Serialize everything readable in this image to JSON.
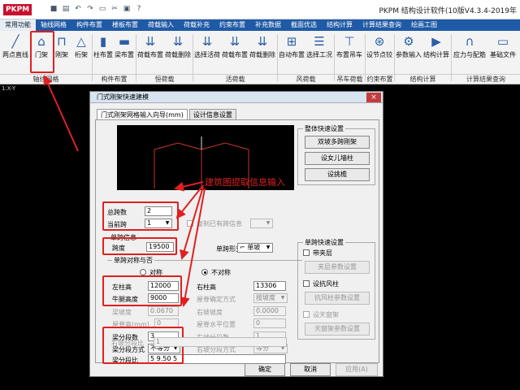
{
  "app": {
    "logo": "PKPM",
    "title": "PKPM 结构设计软件(10版V4.3.4-2019年",
    "quick_icons": [
      "save-icon",
      "print-icon",
      "undo-icon",
      "redo-icon",
      "folder-icon",
      "cut-icon",
      "paste-icon",
      "help-icon"
    ]
  },
  "menubar": {
    "tabs": [
      "常用功能",
      "轴线网格",
      "构件布置",
      "楼板布置",
      "荷载输入",
      "荷载补充",
      "约束布置",
      "补充数据",
      "截面优选",
      "结构计算",
      "计算结果查询",
      "绘画工图"
    ],
    "active": 0
  },
  "ribbon": {
    "buttons": [
      {
        "label": "两点直线",
        "icon": "line-icon"
      },
      {
        "label": "门架",
        "icon": "portal-frame-icon"
      },
      {
        "label": "刚架",
        "icon": "frame-icon"
      },
      {
        "label": "桁架",
        "icon": "truss-icon"
      },
      {
        "label": "柱布置",
        "icon": "column-icon"
      },
      {
        "label": "梁布置",
        "icon": "beam-icon"
      },
      {
        "label": "荷载布置",
        "icon": "load-icon"
      },
      {
        "label": "荷载删除",
        "icon": "load-delete-icon"
      },
      {
        "label": "选择活荷",
        "icon": "live-load-icon"
      },
      {
        "label": "荷载布置",
        "icon": "load-icon"
      },
      {
        "label": "荷载删除",
        "icon": "load-delete-icon"
      },
      {
        "label": "自动布置",
        "icon": "auto-icon"
      },
      {
        "label": "选择工况",
        "icon": "case-icon"
      },
      {
        "label": "布置吊车",
        "icon": "crane-icon"
      },
      {
        "label": "设节点铰",
        "icon": "hinge-icon"
      },
      {
        "label": "参数输入",
        "icon": "param-icon"
      },
      {
        "label": "结构计算",
        "icon": "run-icon"
      },
      {
        "label": "应力与配筋",
        "icon": "stress-icon"
      },
      {
        "label": "基础文件",
        "icon": "file-icon"
      }
    ],
    "groups": [
      "轴线网格",
      "构件布置",
      "恒荷载",
      "活荷载",
      "风荷载",
      "吊车荷载",
      "约束布置",
      "结构计算",
      "计算结果查询"
    ]
  },
  "cad": {
    "coord": "1:X-Y"
  },
  "dialog": {
    "title": "门式刚架快速建模",
    "tabs": [
      "门式刚架网格输入向导(mm)",
      "设计信息设置"
    ],
    "total_spans_label": "总跨数",
    "total_spans": "2",
    "current_span_label": "当前跨",
    "current_span": "1",
    "copy_span_label": "复制已有跨信息",
    "single_span_info_label": "单跨信息",
    "span_label": "跨度",
    "span_value": "19500",
    "span_shape_label": "单跨形式",
    "span_shape_value": "单坡",
    "symmetry_label": "单跨对称与否",
    "symmetric_label": "对称",
    "asymmetric_label": "不对称",
    "left_col_h_label": "左柱高",
    "left_col_h": "12000",
    "right_col_h_label": "右柱高",
    "right_col_h": "13306",
    "corbel_h_label": "牛腿高度",
    "corbel_h": "9000",
    "ridge_mode_label": "屋脊确定方式",
    "ridge_mode": "按坡度",
    "slope_label": "梁坡度",
    "slope_value": "0.0670",
    "right_slope_label": "右坡坡度",
    "right_slope_value": "0.0000",
    "ridge_h_label": "屋脊高(mm)",
    "ridge_h": "0",
    "ridge_pos_label": "屋脊水平位置",
    "ridge_pos": "0",
    "beam_seg_label": "梁分段数",
    "beam_seg": "3",
    "right_seg_label": "右坡分段数",
    "right_seg": "1",
    "seg_mode_label": "梁分段方式",
    "seg_mode": "不等分",
    "right_seg_mode_label": "右坡分段方式",
    "right_seg_mode": "等分",
    "seg_ratio_label": "梁分段比",
    "seg_ratio": "5 9.50 5",
    "right_ratio_label": "右坡分段比",
    "right_ratio": "1",
    "quick_settings_label": "整体快速设置",
    "btn_double_slope": "双坡多跨刚架",
    "btn_parapet": "设女儿墙柱",
    "btn_canopy": "设挑檐",
    "single_quick_label": "单跨快速设置",
    "mezzanine_label": "带夹层",
    "mezzanine_btn": "夹层参数设置",
    "wind_col_label": "设抗风柱",
    "wind_col_btn": "抗风柱参数设置",
    "skylight_label": "设天窗架",
    "skylight_btn": "天窗架参数设置",
    "ok": "确定",
    "cancel": "取消",
    "apply": "应用(A)"
  },
  "annotation": "建筑图提取信息输入",
  "colors": {
    "accent": "#1f5aa6",
    "highlight": "#e02020",
    "frame_line": "#c0392b"
  }
}
